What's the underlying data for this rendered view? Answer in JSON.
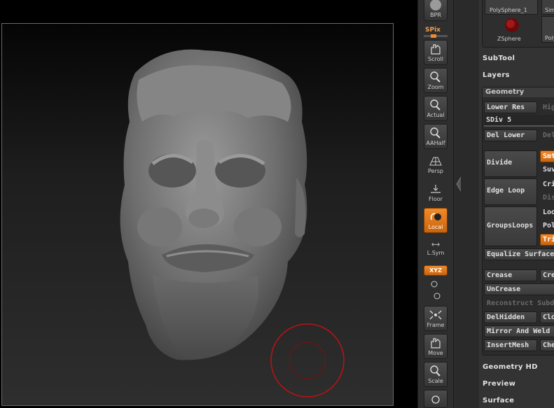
{
  "shelf": {
    "bpr": "BPR",
    "spix": "SPix",
    "scroll": "Scroll",
    "zoom": "Zoom",
    "actual": "Actual",
    "aahalf": "AAHalf",
    "persp": "Persp",
    "floor": "Floor",
    "local": "Local",
    "lsym": "L.Sym",
    "xyz": "XYZ",
    "frame": "Frame",
    "move": "Move",
    "scale": "Scale"
  },
  "palette": {
    "polysphere": "PolySphere_1",
    "sim": "Sim",
    "zsphere": "ZSphere",
    "poly": "Poly",
    "subtool": "SubTool",
    "layers": "Layers",
    "geometry": "Geometry",
    "lower_res": "Lower Res",
    "higher_res": "High",
    "sdiv": "SDiv 5",
    "del_lower": "Del Lower",
    "del_higher": "Del",
    "divide": "Divide",
    "smt": "Smt",
    "suv": "Suv",
    "edge_loop": "Edge Loop",
    "crisp": "Cris",
    "disp": "Disp",
    "grouploops": "GroupsLoops",
    "loops": "Loo",
    "polish": "Poli",
    "triangles": "Tria",
    "equalize": "Equalize Surface",
    "crease": "Crease",
    "crease2": "Crea",
    "uncrease": "UnCrease",
    "reconstruct": "Reconstruct Subd",
    "delhidden": "DelHidden",
    "close": "Clos",
    "mirror": "Mirror And Weld",
    "insertmesh": "InsertMesh",
    "check": "Che",
    "geometry_hd": "Geometry HD",
    "preview": "Preview",
    "surface": "Surface"
  },
  "colors": {
    "accent": "#f08a2a",
    "brush_ring": "#b41414"
  }
}
